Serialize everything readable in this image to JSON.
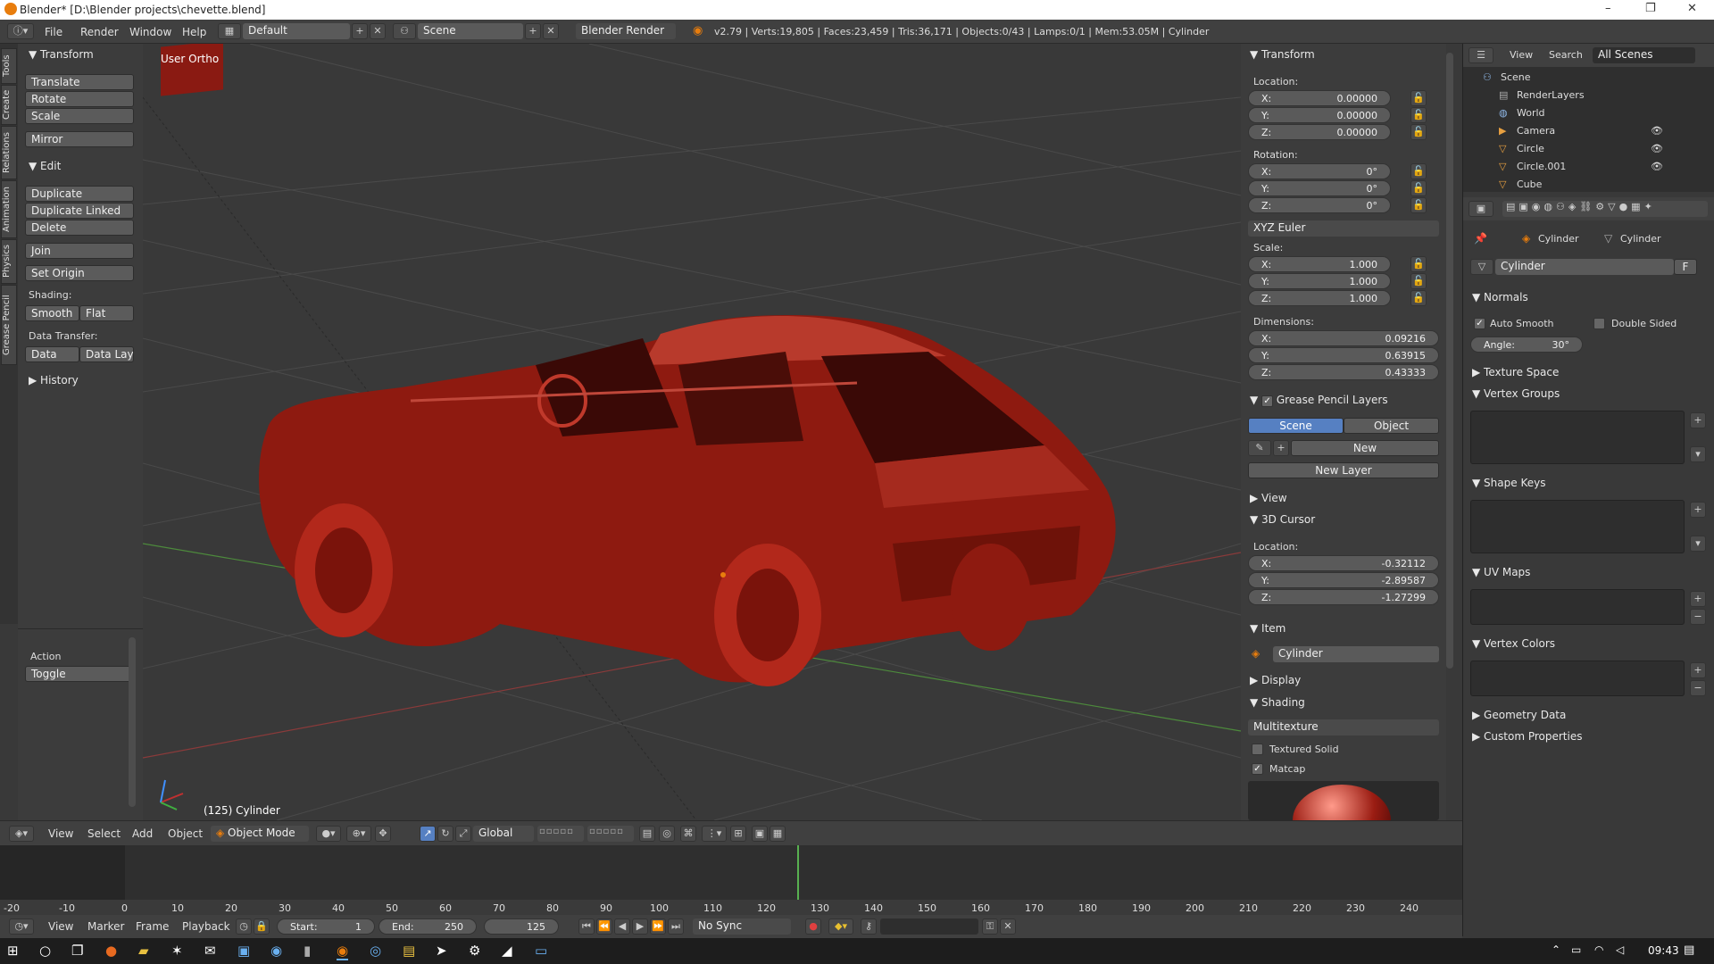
{
  "window": {
    "title": "Blender* [D:\\Blender projects\\chevette.blend]",
    "minimize": "–",
    "restore": "❐",
    "close": "✕"
  },
  "infobar": {
    "menus": [
      "File",
      "Render",
      "Window",
      "Help"
    ],
    "layout": "Default",
    "scene": "Scene",
    "engine": "Blender Render",
    "stats": "v2.79 | Verts:19,805 | Faces:23,459 | Tris:36,171 | Objects:0/43 | Lamps:0/1 | Mem:53.05M | Cylinder"
  },
  "lefttabs": [
    "Tools",
    "Create",
    "Relations",
    "Animation",
    "Physics",
    "Grease Pencil"
  ],
  "tools": {
    "transform_hdr": "Transform",
    "translate": "Translate",
    "rotate": "Rotate",
    "scale": "Scale",
    "mirror": "Mirror",
    "edit_hdr": "Edit",
    "duplicate": "Duplicate",
    "duplicate_linked": "Duplicate Linked",
    "delete": "Delete",
    "join": "Join",
    "set_origin": "Set Origin",
    "shading_lbl": "Shading:",
    "smooth": "Smooth",
    "flat": "Flat",
    "data_transfer_lbl": "Data Transfer:",
    "data": "Data",
    "data_layo": "Data Layo",
    "history_hdr": "History",
    "action_lbl": "Action",
    "toggle": "Toggle"
  },
  "viewport": {
    "view_label": "User Ortho",
    "object_label": "(125) Cylinder"
  },
  "npanel": {
    "transform_hdr": "Transform",
    "location_lbl": "Location:",
    "loc": [
      {
        "k": "X:",
        "v": "0.00000"
      },
      {
        "k": "Y:",
        "v": "0.00000"
      },
      {
        "k": "Z:",
        "v": "0.00000"
      }
    ],
    "rotation_lbl": "Rotation:",
    "rot": [
      {
        "k": "X:",
        "v": "0°"
      },
      {
        "k": "Y:",
        "v": "0°"
      },
      {
        "k": "Z:",
        "v": "0°"
      }
    ],
    "euler": "XYZ Euler",
    "scale_lbl": "Scale:",
    "scale": [
      {
        "k": "X:",
        "v": "1.000"
      },
      {
        "k": "Y:",
        "v": "1.000"
      },
      {
        "k": "Z:",
        "v": "1.000"
      }
    ],
    "dimensions_lbl": "Dimensions:",
    "dim": [
      {
        "k": "X:",
        "v": "0.09216"
      },
      {
        "k": "Y:",
        "v": "0.63915"
      },
      {
        "k": "Z:",
        "v": "0.43333"
      }
    ],
    "gp_hdr": "Grease Pencil Layers",
    "gp_scene": "Scene",
    "gp_object": "Object",
    "gp_new": "New",
    "gp_new_layer": "New Layer",
    "view_hdr": "View",
    "cursor_hdr": "3D Cursor",
    "cursor_loc_lbl": "Location:",
    "cursor": [
      {
        "k": "X:",
        "v": "-0.32112"
      },
      {
        "k": "Y:",
        "v": "-2.89587"
      },
      {
        "k": "Z:",
        "v": "-1.27299"
      }
    ],
    "item_hdr": "Item",
    "item_name": "Cylinder",
    "display_hdr": "Display",
    "shading_hdr": "Shading",
    "shading_mode": "Multitexture",
    "textured_solid": "Textured Solid",
    "matcap": "Matcap"
  },
  "outliner": {
    "view": "View",
    "search": "Search",
    "scenes": "All Scenes",
    "rows": [
      "Scene",
      "RenderLayers",
      "World",
      "Camera",
      "Circle",
      "Circle.001",
      "Cube"
    ]
  },
  "properties": {
    "crumb1": "Cylinder",
    "crumb2": "Cylinder",
    "mesh_name": "Cylinder",
    "fake": "F",
    "normals_hdr": "Normals",
    "auto_smooth": "Auto Smooth",
    "double_sided": "Double Sided",
    "angle": "Angle:",
    "angle_val": "30°",
    "texture_space": "Texture Space",
    "vertex_groups": "Vertex Groups",
    "shape_keys": "Shape Keys",
    "uv_maps": "UV Maps",
    "vertex_colors": "Vertex Colors",
    "geometry_data": "Geometry Data",
    "custom_properties": "Custom Properties"
  },
  "vpheader": {
    "view": "View",
    "select": "Select",
    "add": "Add",
    "object": "Object",
    "mode": "Object Mode",
    "orientation": "Global"
  },
  "timeline": {
    "ticks": [
      "-20",
      "-10",
      "0",
      "10",
      "20",
      "30",
      "40",
      "50",
      "60",
      "70",
      "80",
      "90",
      "100",
      "110",
      "120",
      "130",
      "140",
      "150",
      "160",
      "170",
      "180",
      "190",
      "200",
      "210",
      "220",
      "230",
      "240"
    ],
    "current_frame": "125"
  },
  "tlheader": {
    "view": "View",
    "marker": "Marker",
    "frame": "Frame",
    "playback": "Playback",
    "start_lbl": "Start:",
    "start": "1",
    "end_lbl": "End:",
    "end": "250",
    "current": "125",
    "sync": "No Sync"
  },
  "taskbar": {
    "time": "09:43"
  },
  "colors": {
    "car": "#9a1c12",
    "accent": "#5680c2",
    "grid_x": "#8a3a3a",
    "grid_y": "#4a8a3a"
  }
}
